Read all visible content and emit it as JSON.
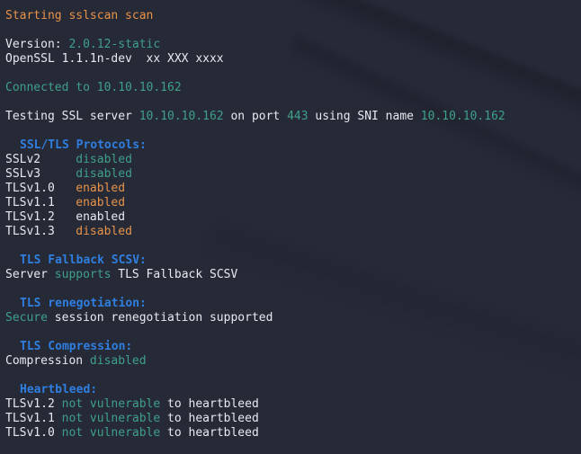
{
  "terminal": {
    "background_color": "#262936",
    "colors": {
      "white": "#e8eaf0",
      "orange": "#e8934a",
      "teal": "#3fa08c",
      "blue": "#2f7fe0"
    },
    "lines": [
      {
        "id": "starting",
        "segments": [
          {
            "text": "Starting sslscan scan",
            "color": "orange"
          }
        ]
      },
      {
        "id": "blank-1",
        "segments": []
      },
      {
        "id": "version",
        "segments": [
          {
            "text": "Version: ",
            "color": "white"
          },
          {
            "text": "2.0.12-static",
            "color": "teal"
          }
        ]
      },
      {
        "id": "openssl",
        "segments": [
          {
            "text": "OpenSSL 1.1.1n-dev  xx XXX xxxx",
            "color": "white"
          }
        ]
      },
      {
        "id": "blank-2",
        "segments": []
      },
      {
        "id": "connected",
        "segments": [
          {
            "text": "Connected to 10.10.10.162",
            "color": "teal"
          }
        ]
      },
      {
        "id": "blank-3",
        "segments": []
      },
      {
        "id": "testing",
        "segments": [
          {
            "text": "Testing SSL server ",
            "color": "white"
          },
          {
            "text": "10.10.10.162",
            "color": "teal"
          },
          {
            "text": " on port ",
            "color": "white"
          },
          {
            "text": "443",
            "color": "teal"
          },
          {
            "text": " using SNI name ",
            "color": "white"
          },
          {
            "text": "10.10.10.162",
            "color": "teal"
          }
        ]
      },
      {
        "id": "blank-4",
        "segments": []
      },
      {
        "id": "heading-protocols",
        "heading": true,
        "segments": [
          {
            "text": "SSL/TLS Protocols:",
            "color": "blue"
          }
        ]
      },
      {
        "id": "sslv2",
        "segments": [
          {
            "text": "SSLv2     ",
            "color": "white"
          },
          {
            "text": "disabled",
            "color": "teal"
          }
        ]
      },
      {
        "id": "sslv3",
        "segments": [
          {
            "text": "SSLv3     ",
            "color": "white"
          },
          {
            "text": "disabled",
            "color": "teal"
          }
        ]
      },
      {
        "id": "tlsv10",
        "segments": [
          {
            "text": "TLSv1.0   ",
            "color": "white"
          },
          {
            "text": "enabled",
            "color": "orange"
          }
        ]
      },
      {
        "id": "tlsv11",
        "segments": [
          {
            "text": "TLSv1.1   ",
            "color": "white"
          },
          {
            "text": "enabled",
            "color": "orange"
          }
        ]
      },
      {
        "id": "tlsv12",
        "segments": [
          {
            "text": "TLSv1.2   ",
            "color": "white"
          },
          {
            "text": "enabled",
            "color": "white"
          }
        ]
      },
      {
        "id": "tlsv13",
        "segments": [
          {
            "text": "TLSv1.3   ",
            "color": "white"
          },
          {
            "text": "disabled",
            "color": "orange"
          }
        ]
      },
      {
        "id": "blank-5",
        "segments": []
      },
      {
        "id": "heading-fallback",
        "heading": true,
        "segments": [
          {
            "text": "TLS Fallback SCSV:",
            "color": "blue"
          }
        ]
      },
      {
        "id": "fallback-result",
        "segments": [
          {
            "text": "Server ",
            "color": "white"
          },
          {
            "text": "supports",
            "color": "teal"
          },
          {
            "text": " TLS Fallback SCSV",
            "color": "white"
          }
        ]
      },
      {
        "id": "blank-6",
        "segments": []
      },
      {
        "id": "heading-renegotiation",
        "heading": true,
        "segments": [
          {
            "text": "TLS renegotiation:",
            "color": "blue"
          }
        ]
      },
      {
        "id": "renegotiation-result",
        "segments": [
          {
            "text": "Secure",
            "color": "teal"
          },
          {
            "text": " session renegotiation supported",
            "color": "white"
          }
        ]
      },
      {
        "id": "blank-7",
        "segments": []
      },
      {
        "id": "heading-compression",
        "heading": true,
        "segments": [
          {
            "text": "TLS Compression:",
            "color": "blue"
          }
        ]
      },
      {
        "id": "compression-result",
        "segments": [
          {
            "text": "Compression ",
            "color": "white"
          },
          {
            "text": "disabled",
            "color": "teal"
          }
        ]
      },
      {
        "id": "blank-8",
        "segments": []
      },
      {
        "id": "heading-heartbleed",
        "heading": true,
        "segments": [
          {
            "text": "Heartbleed:",
            "color": "blue"
          }
        ]
      },
      {
        "id": "heartbleed-tlsv12",
        "segments": [
          {
            "text": "TLSv1.2 ",
            "color": "white"
          },
          {
            "text": "not vulnerable",
            "color": "teal"
          },
          {
            "text": " to heartbleed",
            "color": "white"
          }
        ]
      },
      {
        "id": "heartbleed-tlsv11",
        "segments": [
          {
            "text": "TLSv1.1 ",
            "color": "white"
          },
          {
            "text": "not vulnerable",
            "color": "teal"
          },
          {
            "text": " to heartbleed",
            "color": "white"
          }
        ]
      },
      {
        "id": "heartbleed-tlsv10",
        "segments": [
          {
            "text": "TLSv1.0 ",
            "color": "white"
          },
          {
            "text": "not vulnerable",
            "color": "teal"
          },
          {
            "text": " to heartbleed",
            "color": "white"
          }
        ]
      }
    ]
  }
}
